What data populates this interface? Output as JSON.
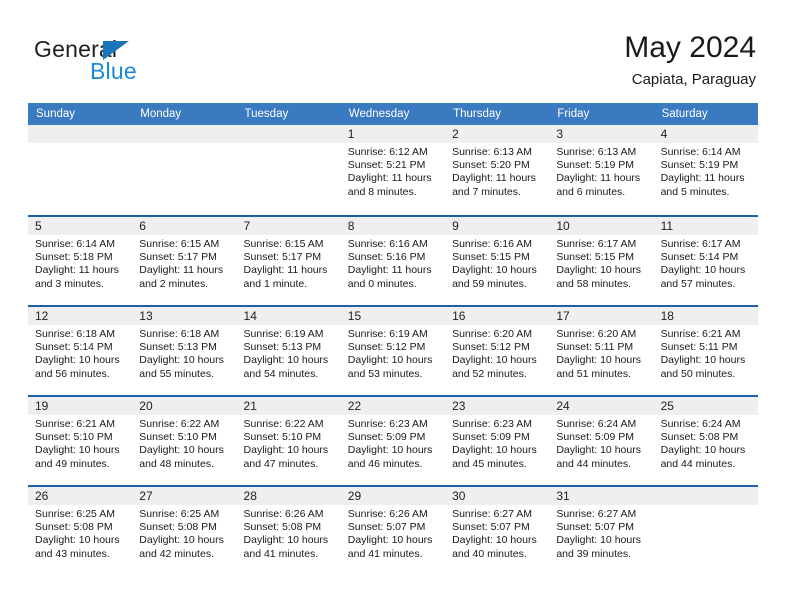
{
  "brand": {
    "name_top": "General",
    "name_bottom": "Blue",
    "accent_color": "#1b8ad6",
    "triangle_color": "#1b75bb"
  },
  "header": {
    "title": "May 2024",
    "subtitle": "Capiata, Paraguay"
  },
  "theme": {
    "header_bg": "#3a7ac0",
    "row_divider": "#1f5fa9",
    "daynum_strip": "#efefef",
    "text": "#1a1a1a"
  },
  "weekdays": [
    "Sunday",
    "Monday",
    "Tuesday",
    "Wednesday",
    "Thursday",
    "Friday",
    "Saturday"
  ],
  "calendar": {
    "weeks": [
      [
        {
          "day": "",
          "sunrise": "",
          "sunset": "",
          "daylight_1": "",
          "daylight_2": ""
        },
        {
          "day": "",
          "sunrise": "",
          "sunset": "",
          "daylight_1": "",
          "daylight_2": ""
        },
        {
          "day": "",
          "sunrise": "",
          "sunset": "",
          "daylight_1": "",
          "daylight_2": ""
        },
        {
          "day": "1",
          "sunrise": "Sunrise: 6:12 AM",
          "sunset": "Sunset: 5:21 PM",
          "daylight_1": "Daylight: 11 hours",
          "daylight_2": "and 8 minutes."
        },
        {
          "day": "2",
          "sunrise": "Sunrise: 6:13 AM",
          "sunset": "Sunset: 5:20 PM",
          "daylight_1": "Daylight: 11 hours",
          "daylight_2": "and 7 minutes."
        },
        {
          "day": "3",
          "sunrise": "Sunrise: 6:13 AM",
          "sunset": "Sunset: 5:19 PM",
          "daylight_1": "Daylight: 11 hours",
          "daylight_2": "and 6 minutes."
        },
        {
          "day": "4",
          "sunrise": "Sunrise: 6:14 AM",
          "sunset": "Sunset: 5:19 PM",
          "daylight_1": "Daylight: 11 hours",
          "daylight_2": "and 5 minutes."
        }
      ],
      [
        {
          "day": "5",
          "sunrise": "Sunrise: 6:14 AM",
          "sunset": "Sunset: 5:18 PM",
          "daylight_1": "Daylight: 11 hours",
          "daylight_2": "and 3 minutes."
        },
        {
          "day": "6",
          "sunrise": "Sunrise: 6:15 AM",
          "sunset": "Sunset: 5:17 PM",
          "daylight_1": "Daylight: 11 hours",
          "daylight_2": "and 2 minutes."
        },
        {
          "day": "7",
          "sunrise": "Sunrise: 6:15 AM",
          "sunset": "Sunset: 5:17 PM",
          "daylight_1": "Daylight: 11 hours",
          "daylight_2": "and 1 minute."
        },
        {
          "day": "8",
          "sunrise": "Sunrise: 6:16 AM",
          "sunset": "Sunset: 5:16 PM",
          "daylight_1": "Daylight: 11 hours",
          "daylight_2": "and 0 minutes."
        },
        {
          "day": "9",
          "sunrise": "Sunrise: 6:16 AM",
          "sunset": "Sunset: 5:15 PM",
          "daylight_1": "Daylight: 10 hours",
          "daylight_2": "and 59 minutes."
        },
        {
          "day": "10",
          "sunrise": "Sunrise: 6:17 AM",
          "sunset": "Sunset: 5:15 PM",
          "daylight_1": "Daylight: 10 hours",
          "daylight_2": "and 58 minutes."
        },
        {
          "day": "11",
          "sunrise": "Sunrise: 6:17 AM",
          "sunset": "Sunset: 5:14 PM",
          "daylight_1": "Daylight: 10 hours",
          "daylight_2": "and 57 minutes."
        }
      ],
      [
        {
          "day": "12",
          "sunrise": "Sunrise: 6:18 AM",
          "sunset": "Sunset: 5:14 PM",
          "daylight_1": "Daylight: 10 hours",
          "daylight_2": "and 56 minutes."
        },
        {
          "day": "13",
          "sunrise": "Sunrise: 6:18 AM",
          "sunset": "Sunset: 5:13 PM",
          "daylight_1": "Daylight: 10 hours",
          "daylight_2": "and 55 minutes."
        },
        {
          "day": "14",
          "sunrise": "Sunrise: 6:19 AM",
          "sunset": "Sunset: 5:13 PM",
          "daylight_1": "Daylight: 10 hours",
          "daylight_2": "and 54 minutes."
        },
        {
          "day": "15",
          "sunrise": "Sunrise: 6:19 AM",
          "sunset": "Sunset: 5:12 PM",
          "daylight_1": "Daylight: 10 hours",
          "daylight_2": "and 53 minutes."
        },
        {
          "day": "16",
          "sunrise": "Sunrise: 6:20 AM",
          "sunset": "Sunset: 5:12 PM",
          "daylight_1": "Daylight: 10 hours",
          "daylight_2": "and 52 minutes."
        },
        {
          "day": "17",
          "sunrise": "Sunrise: 6:20 AM",
          "sunset": "Sunset: 5:11 PM",
          "daylight_1": "Daylight: 10 hours",
          "daylight_2": "and 51 minutes."
        },
        {
          "day": "18",
          "sunrise": "Sunrise: 6:21 AM",
          "sunset": "Sunset: 5:11 PM",
          "daylight_1": "Daylight: 10 hours",
          "daylight_2": "and 50 minutes."
        }
      ],
      [
        {
          "day": "19",
          "sunrise": "Sunrise: 6:21 AM",
          "sunset": "Sunset: 5:10 PM",
          "daylight_1": "Daylight: 10 hours",
          "daylight_2": "and 49 minutes."
        },
        {
          "day": "20",
          "sunrise": "Sunrise: 6:22 AM",
          "sunset": "Sunset: 5:10 PM",
          "daylight_1": "Daylight: 10 hours",
          "daylight_2": "and 48 minutes."
        },
        {
          "day": "21",
          "sunrise": "Sunrise: 6:22 AM",
          "sunset": "Sunset: 5:10 PM",
          "daylight_1": "Daylight: 10 hours",
          "daylight_2": "and 47 minutes."
        },
        {
          "day": "22",
          "sunrise": "Sunrise: 6:23 AM",
          "sunset": "Sunset: 5:09 PM",
          "daylight_1": "Daylight: 10 hours",
          "daylight_2": "and 46 minutes."
        },
        {
          "day": "23",
          "sunrise": "Sunrise: 6:23 AM",
          "sunset": "Sunset: 5:09 PM",
          "daylight_1": "Daylight: 10 hours",
          "daylight_2": "and 45 minutes."
        },
        {
          "day": "24",
          "sunrise": "Sunrise: 6:24 AM",
          "sunset": "Sunset: 5:09 PM",
          "daylight_1": "Daylight: 10 hours",
          "daylight_2": "and 44 minutes."
        },
        {
          "day": "25",
          "sunrise": "Sunrise: 6:24 AM",
          "sunset": "Sunset: 5:08 PM",
          "daylight_1": "Daylight: 10 hours",
          "daylight_2": "and 44 minutes."
        }
      ],
      [
        {
          "day": "26",
          "sunrise": "Sunrise: 6:25 AM",
          "sunset": "Sunset: 5:08 PM",
          "daylight_1": "Daylight: 10 hours",
          "daylight_2": "and 43 minutes."
        },
        {
          "day": "27",
          "sunrise": "Sunrise: 6:25 AM",
          "sunset": "Sunset: 5:08 PM",
          "daylight_1": "Daylight: 10 hours",
          "daylight_2": "and 42 minutes."
        },
        {
          "day": "28",
          "sunrise": "Sunrise: 6:26 AM",
          "sunset": "Sunset: 5:08 PM",
          "daylight_1": "Daylight: 10 hours",
          "daylight_2": "and 41 minutes."
        },
        {
          "day": "29",
          "sunrise": "Sunrise: 6:26 AM",
          "sunset": "Sunset: 5:07 PM",
          "daylight_1": "Daylight: 10 hours",
          "daylight_2": "and 41 minutes."
        },
        {
          "day": "30",
          "sunrise": "Sunrise: 6:27 AM",
          "sunset": "Sunset: 5:07 PM",
          "daylight_1": "Daylight: 10 hours",
          "daylight_2": "and 40 minutes."
        },
        {
          "day": "31",
          "sunrise": "Sunrise: 6:27 AM",
          "sunset": "Sunset: 5:07 PM",
          "daylight_1": "Daylight: 10 hours",
          "daylight_2": "and 39 minutes."
        },
        {
          "day": "",
          "sunrise": "",
          "sunset": "",
          "daylight_1": "",
          "daylight_2": ""
        }
      ]
    ]
  }
}
